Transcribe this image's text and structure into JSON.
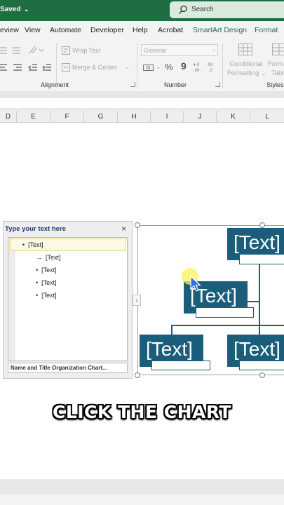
{
  "titlebar": {
    "status": "Saved",
    "search_placeholder": "Search"
  },
  "tabs": [
    "eview",
    "View",
    "Automate",
    "Developer",
    "Help",
    "Acrobat",
    "SmartArt Design",
    "Format"
  ],
  "ribbon": {
    "wrap_text": "Wrap Text",
    "merge_center": "Merge & Center",
    "number_format": "General",
    "cond_formatting_1": "Conditional",
    "cond_formatting_2": "Formatting",
    "format_table_1": "Forma",
    "format_table_2": "Table",
    "groups": {
      "alignment": "Alignment",
      "number": "Number",
      "styles": "Styles"
    }
  },
  "columns": [
    "D",
    "E",
    "F",
    "G",
    "H",
    "I",
    "J",
    "K",
    "L"
  ],
  "text_pane": {
    "title": "Type your text here",
    "close": "×",
    "items": [
      "[Text]",
      "[Text]",
      "[Text]",
      "[Text]",
      "[Text]"
    ],
    "footer": "Name and Title Organization Chart..."
  },
  "org_chart": {
    "nodes": [
      "[Text]",
      "[Text]",
      "[Text]",
      "[Text]"
    ]
  },
  "caption": "CLICK THE CHART",
  "colors": {
    "excel_green": "#1e6e42",
    "smartart_blue": "#1a5e7b"
  }
}
